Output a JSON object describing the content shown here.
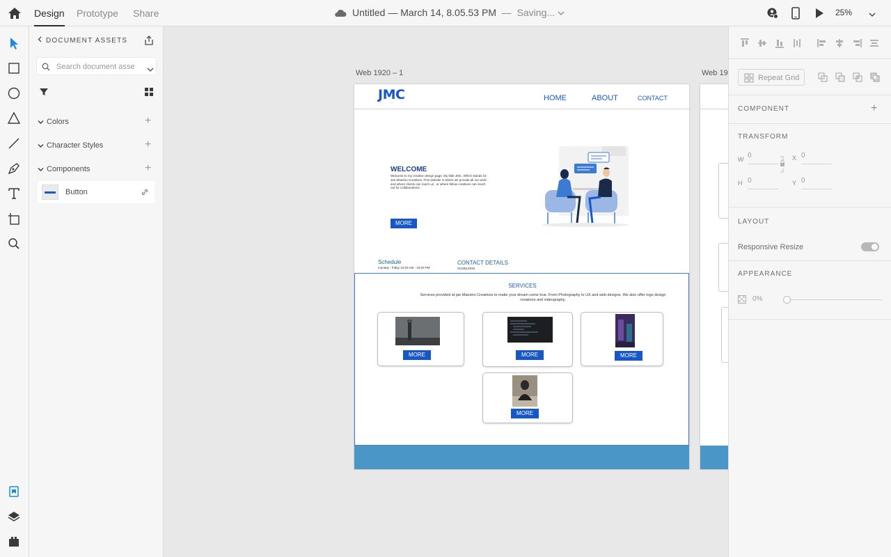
{
  "topbar": {
    "tabs": [
      "Design",
      "Prototype",
      "Share"
    ],
    "active_tab": "Design",
    "doc_title": "Untitled — March 14, 8.05.53 PM",
    "doc_status": "Saving...",
    "zoom": "25%"
  },
  "toolbar": {
    "tools": [
      "select-tool",
      "rectangle-tool",
      "ellipse-tool",
      "polygon-tool",
      "line-tool",
      "pen-tool",
      "text-tool",
      "artboard-tool",
      "zoom-tool"
    ],
    "bottom": [
      "assets-panel-icon",
      "layers-icon",
      "plugins-icon"
    ]
  },
  "assets": {
    "header": "DOCUMENT ASSETS",
    "search_placeholder": "Search document assets",
    "sections": [
      "Colors",
      "Character Styles",
      "Components"
    ],
    "component_item": "Button"
  },
  "canvas": {
    "artboard1_label": "Web 1920 – 1",
    "artboard2_label": "Web 19",
    "site": {
      "logo": "JMC",
      "nav": [
        "HOME",
        "ABOUT",
        "CONTACT"
      ],
      "welcome_title": "WELCOME",
      "welcome_body": "Welcome to my creative design page. My little JMC. Which stands for Jae Maestro Creatives. This website is where we provide all our work and where clients can reach us , or where fellow creatives can reach out for collaborations.",
      "more": "MORE",
      "schedule_title": "Schedule",
      "schedule_body": "monday - friday 10:00 AM - 18:00 PM",
      "contact_title": "CONTACT DETAILS",
      "contact_body": "0133512818",
      "services_title": "SERVICES",
      "services_body": "Services provided at jae Maestro Creatives to make your dream come true. From Photography to UX and web designs. We also offer logo design creations and videography."
    }
  },
  "props": {
    "repeat_grid": "Repeat Grid",
    "component": "COMPONENT",
    "transform": "TRANSFORM",
    "w_label": "W",
    "h_label": "H",
    "x_label": "X",
    "y_label": "Y",
    "w": "0",
    "h": "0",
    "x": "0",
    "y": "0",
    "layout": "LAYOUT",
    "responsive_resize": "Responsive Resize",
    "appearance": "APPEARANCE",
    "opacity": "0%"
  },
  "colors": {
    "accent": "#1757c7",
    "footer": "#4a97c7"
  }
}
